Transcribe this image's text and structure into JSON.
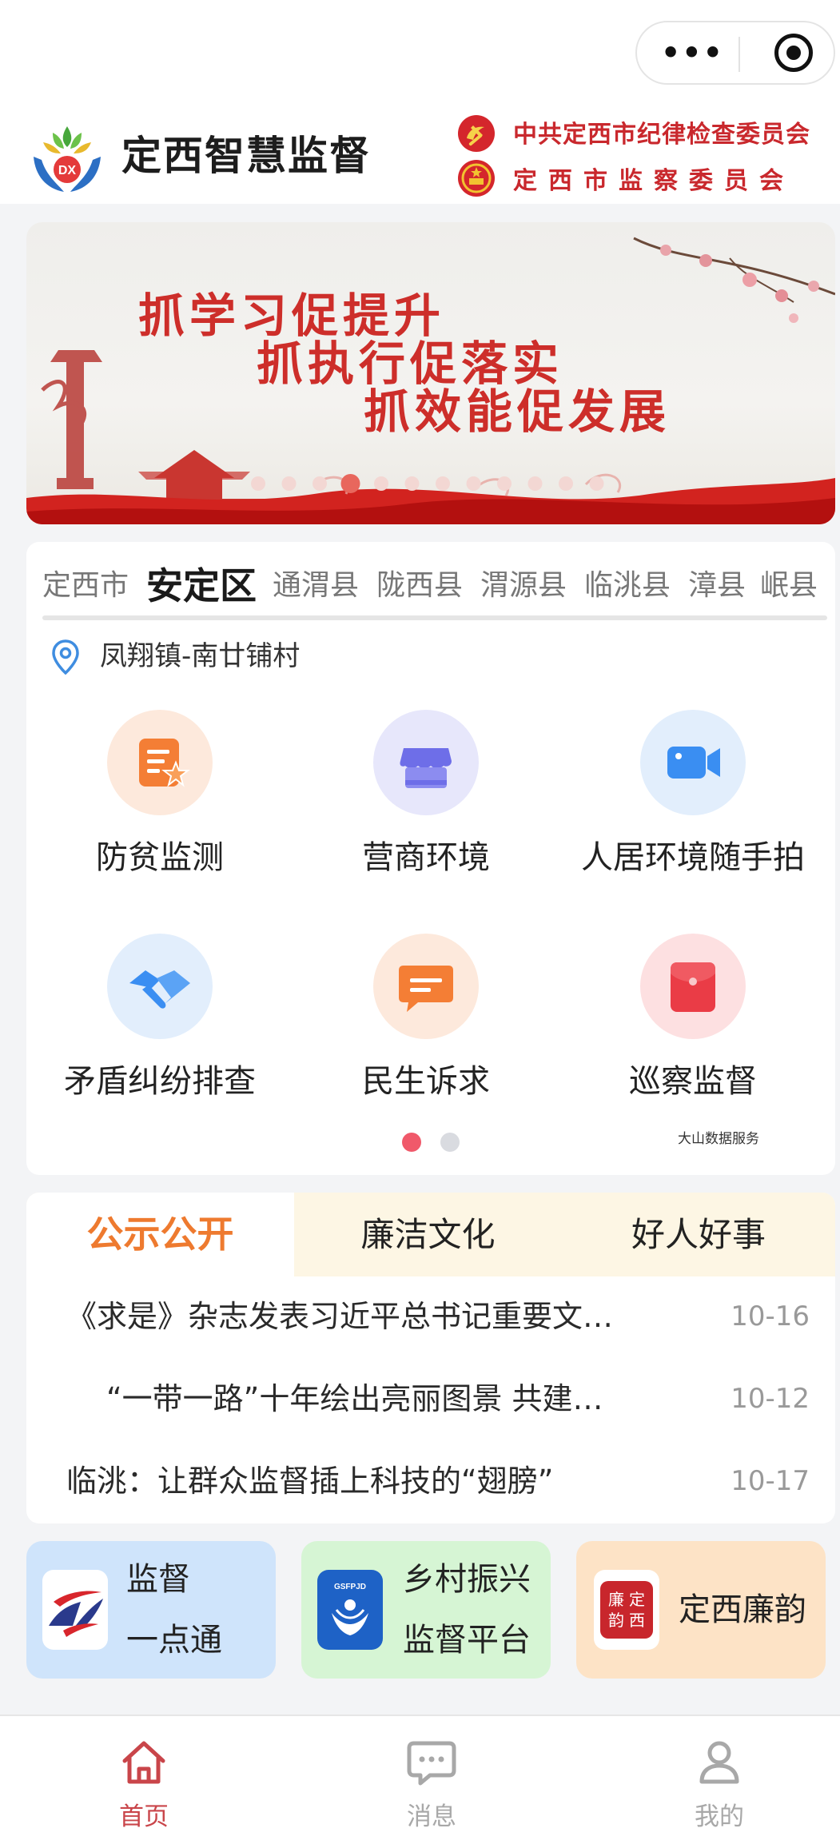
{
  "header": {
    "app_title": "定西智慧监督",
    "org_line1": "中共定西市纪律检查委员会",
    "org_line2": "定西市监察委员会",
    "logo_text": "DX"
  },
  "capsule": {
    "more_label": "•••"
  },
  "banner": {
    "lines": [
      "抓学习促提升",
      "抓执行促落实",
      "抓效能促发展"
    ],
    "page_count": 12,
    "active_index": 3
  },
  "regions": {
    "items": [
      "定西市",
      "安定区",
      "通渭县",
      "陇西县",
      "渭源县",
      "临洮县",
      "漳县",
      "岷县"
    ],
    "active_index": 1,
    "location": "凤翔镇-南廿铺村"
  },
  "services": [
    {
      "label": "防贫监测",
      "icon": "document-star-icon",
      "color": "#f47e35"
    },
    {
      "label": "营商环境",
      "icon": "shop-icon",
      "color": "#6e6ee8"
    },
    {
      "label": "人居环境随手拍",
      "icon": "video-camera-icon",
      "color": "#3a8ef2"
    },
    {
      "label": "矛盾纠纷排查",
      "icon": "handshake-icon",
      "color": "#3a8ef2"
    },
    {
      "label": "民生诉求",
      "icon": "message-icon",
      "color": "#f47e35"
    },
    {
      "label": "巡察监督",
      "icon": "red-envelope-icon",
      "color": "#ea3c46"
    }
  ],
  "services_watermark": "大山数据服务",
  "services_pages": {
    "count": 2,
    "active": 0
  },
  "news": {
    "tabs": [
      "公示公开",
      "廉洁文化",
      "好人好事"
    ],
    "active_tab": 0,
    "items": [
      {
        "title": "《求是》杂志发表习近平总书记重要文…",
        "date": "10-16"
      },
      {
        "title": "“一带一路”十年绘出亮丽图景 共建…",
        "date": "10-12"
      },
      {
        "title": "临洮：让群众监督插上科技的“翅膀”",
        "date": "10-17"
      }
    ]
  },
  "quick_links": [
    {
      "line1": "监督",
      "line2": "一点通",
      "bg": "#cfe4fb"
    },
    {
      "line1": "乡村振兴",
      "line2": "监督平台",
      "bg": "#d6f5d4",
      "badge": "GSFPJD"
    },
    {
      "line1": "定西廉韵",
      "bg": "#fde3c6",
      "seal": "廉韵定西"
    }
  ],
  "bottom_nav": [
    {
      "label": "首页",
      "icon": "home-icon"
    },
    {
      "label": "消息",
      "icon": "chat-icon"
    },
    {
      "label": "我的",
      "icon": "user-icon"
    }
  ],
  "colors": {
    "accent_orange": "#ee7a2f",
    "nav_active": "#c9454a",
    "nav_inactive": "#a8a8a8",
    "party_red": "#c9282d"
  }
}
